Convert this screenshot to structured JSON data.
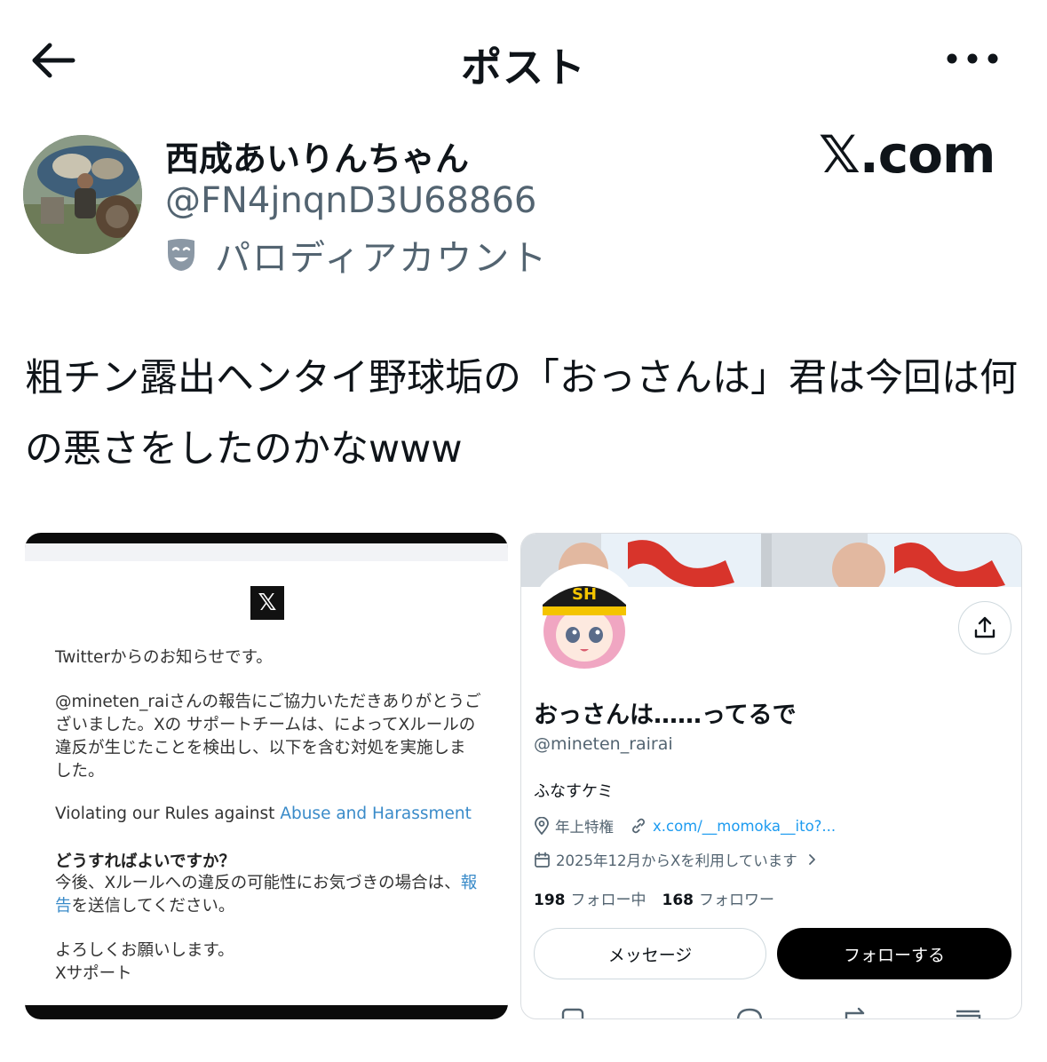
{
  "header": {
    "title": "ポスト"
  },
  "author": {
    "display_name": "西成あいりんちゃん",
    "handle": "@FN4jnqnD3U68866",
    "label": "パロディアカウント"
  },
  "watermark": "𝕏.com",
  "tweet": {
    "text": "粗チン露出ヘンタイ野球垢の「おっさんは」君は今回は何の悪さをしたのかなwww"
  },
  "media_left": {
    "logo": "𝕏",
    "greeting": "Twitterからのお知らせです。",
    "body": "@mineten_raiさんの報告にご協力いただきありがとうございました。Xの サポートチームは、によってXルールの違反が生じたことを検出し、以下を含む対処を実施しました。",
    "violation_prefix": "Violating our Rules against ",
    "violation_link": "Abuse and Harassment",
    "question": "どうすればよいですか？",
    "advice_prefix": "今後、Xルールへの違反の可能性にお気づきの場合は、",
    "advice_link": "報告",
    "advice_suffix": "を送信してください。",
    "closing": "よろしくお願いします。",
    "signature": "Xサポート"
  },
  "media_right": {
    "name": "おっさんは……ってるで",
    "handle": "@mineten_rairai",
    "bio": "ふなすケミ",
    "location": "年上特権",
    "link": "x.com/__momoka__ito?...",
    "joined": "2025年12月からXを利用しています",
    "following_count": "198",
    "following_label": "フォロー中",
    "followers_count": "168",
    "followers_label": "フォロワー",
    "message_button": "メッセージ",
    "follow_button": "フォローする"
  },
  "icons": {
    "back": "arrow-left-icon",
    "more": "more-horizontal-icon",
    "parody": "theater-mask-icon",
    "share": "share-icon",
    "location": "location-pin-icon",
    "link": "link-icon",
    "calendar": "calendar-icon"
  },
  "colors": {
    "text": "#0f1419",
    "secondary": "#536471",
    "link": "#1d9bf0",
    "follow_button": "#000000"
  }
}
